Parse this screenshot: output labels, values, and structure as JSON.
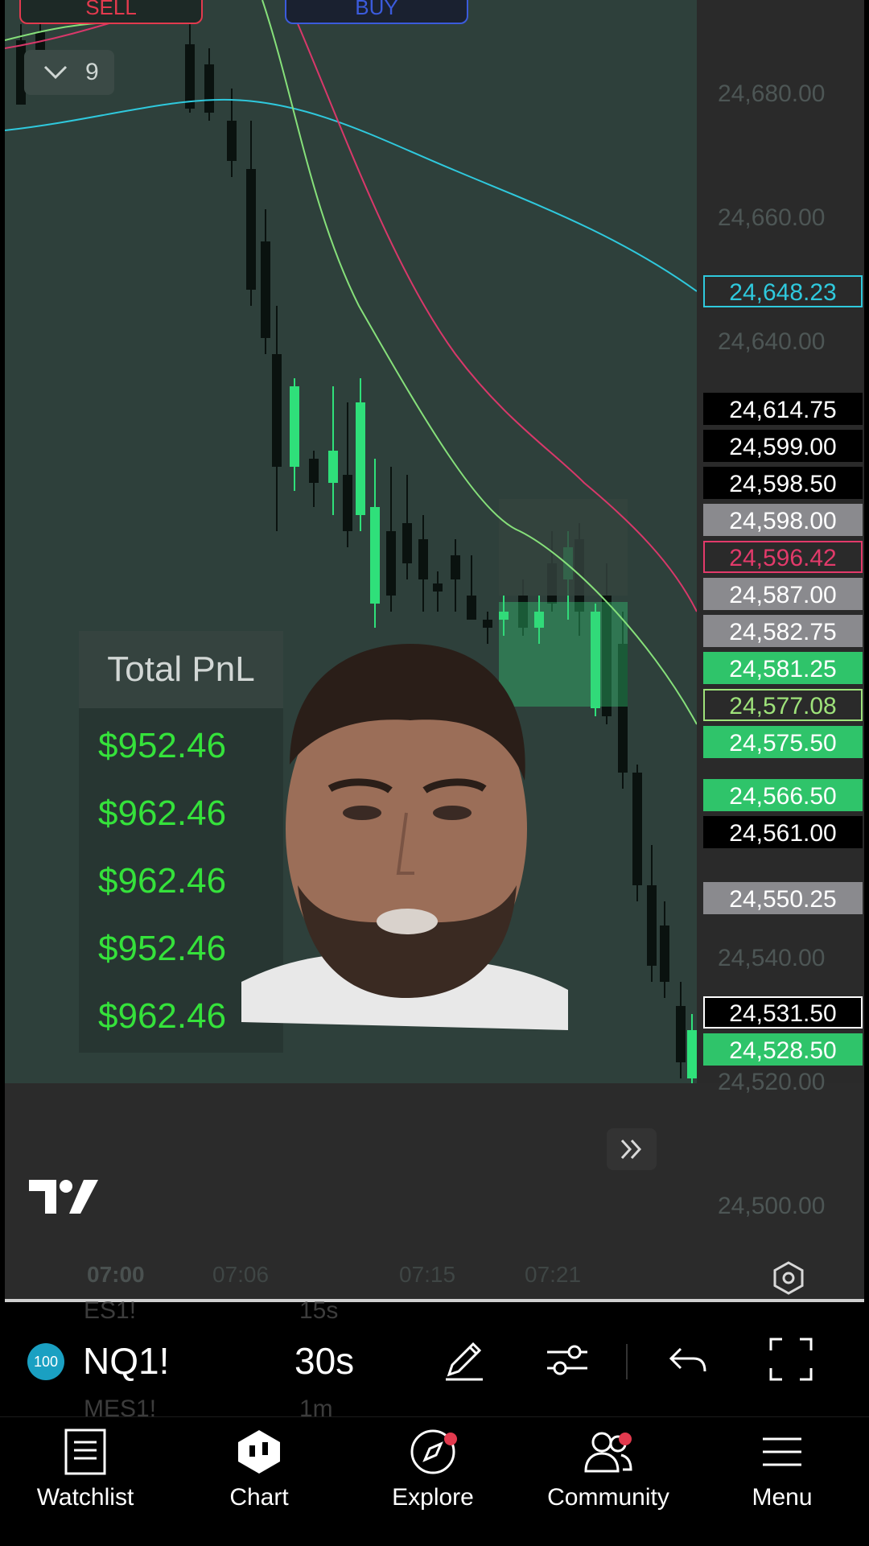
{
  "top_buttons": {
    "sell": "SELL",
    "buy": "BUY"
  },
  "indicator_toggle": {
    "count": "9"
  },
  "price_axis": [
    "24,680.00",
    "24,660.00",
    "24,640.00",
    "24,540.00",
    "24,520.00",
    "24,500.00"
  ],
  "price_tags": [
    {
      "value": "24,648.23",
      "fg": "#2fc9dd",
      "bg": "#2a2a2a",
      "border": "#2fc9dd"
    },
    {
      "value": "24,614.75",
      "fg": "#ffffff",
      "bg": "#000000",
      "border": "#000000"
    },
    {
      "value": "24,599.00",
      "fg": "#ffffff",
      "bg": "#000000",
      "border": "#000000"
    },
    {
      "value": "24,598.50",
      "fg": "#ffffff",
      "bg": "#000000",
      "border": "#000000"
    },
    {
      "value": "24,598.00",
      "fg": "#ffffff",
      "bg": "#8a8a8e",
      "border": "#8a8a8e"
    },
    {
      "value": "24,596.42",
      "fg": "#e23a6a",
      "bg": "#2a2a2a",
      "border": "#e23a6a"
    },
    {
      "value": "24,587.00",
      "fg": "#ffffff",
      "bg": "#8a8a8e",
      "border": "#8a8a8e"
    },
    {
      "value": "24,582.75",
      "fg": "#ffffff",
      "bg": "#8a8a8e",
      "border": "#8a8a8e"
    },
    {
      "value": "24,581.25",
      "fg": "#ffffff",
      "bg": "#2fc46a",
      "border": "#2fc46a"
    },
    {
      "value": "24,577.08",
      "fg": "#9ee27a",
      "bg": "#2a2a2a",
      "border": "#9ee27a"
    },
    {
      "value": "24,575.50",
      "fg": "#ffffff",
      "bg": "#2fc46a",
      "border": "#2fc46a"
    },
    {
      "value": "24,566.50",
      "fg": "#ffffff",
      "bg": "#2fc46a",
      "border": "#2fc46a"
    },
    {
      "value": "24,561.00",
      "fg": "#ffffff",
      "bg": "#000000",
      "border": "#000000"
    },
    {
      "value": "24,550.25",
      "fg": "#ffffff",
      "bg": "#8a8a8e",
      "border": "#8a8a8e"
    },
    {
      "value": "24,531.50",
      "fg": "#ffffff",
      "bg": "#000000",
      "border": "#ffffff"
    },
    {
      "value": "24,528.50",
      "fg": "#ffffff",
      "bg": "#2fc46a",
      "border": "#2fc46a"
    }
  ],
  "time_axis": [
    "07:00",
    "07:06",
    "07:15",
    "07:21"
  ],
  "pnl": {
    "title": "Total PnL",
    "values": [
      "$952.46",
      "$962.46",
      "$962.46",
      "$952.46",
      "$962.46"
    ]
  },
  "toolbar": {
    "badge": "100",
    "symbol": "NQ1!",
    "interval": "30s",
    "ghost_symbol_above": "ES1!",
    "ghost_interval_above": "15s",
    "ghost_symbol_below": "MES1!",
    "ghost_interval_below": "1m"
  },
  "nav": {
    "watchlist": "Watchlist",
    "chart": "Chart",
    "explore": "Explore",
    "community": "Community",
    "menu": "Menu"
  },
  "colors": {
    "chart_bg": "#2e403b",
    "bull": "#2fe07a",
    "bear": "#0a120f",
    "ma_cyan": "#2fc9dd",
    "ma_red": "#d8386a",
    "ma_green": "#86e07a",
    "accent_red": "#e23a4e"
  },
  "icons": [
    "chevron-down-icon",
    "tradingview-logo-icon",
    "double-chevron-right-icon",
    "hexagon-settings-icon",
    "pencil-icon",
    "sliders-icon",
    "undo-icon",
    "fullscreen-icon",
    "watchlist-icon",
    "chart-icon",
    "explore-icon",
    "community-icon",
    "menu-icon"
  ]
}
